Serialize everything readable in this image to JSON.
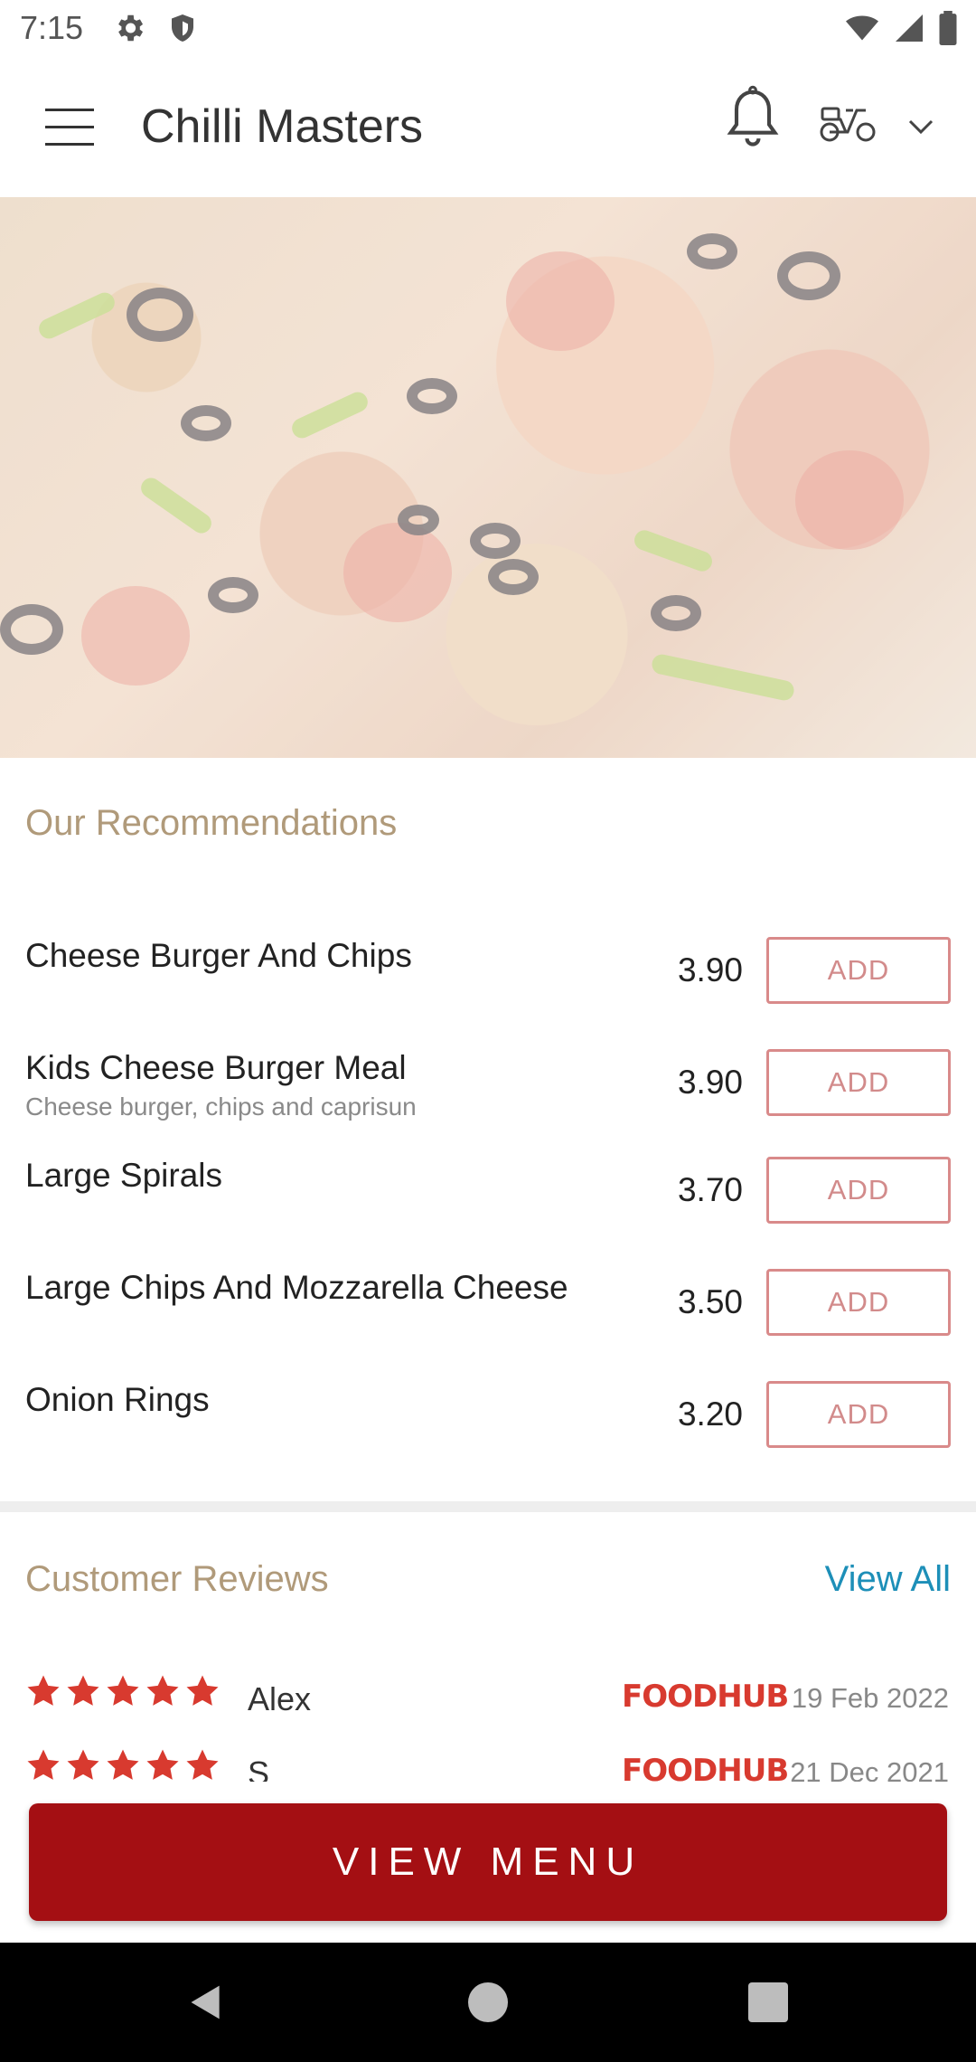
{
  "status_bar": {
    "time": "7:15",
    "left_icons": [
      "gear-icon",
      "shield-icon"
    ],
    "right_icons": [
      "wifi-icon",
      "signal-icon",
      "battery-icon"
    ]
  },
  "app_bar": {
    "title": "Chilli Masters",
    "icons": [
      "menu-icon",
      "bell-icon",
      "scooter-icon",
      "chevron-down-icon"
    ]
  },
  "recommendations": {
    "title": "Our Recommendations",
    "items": [
      {
        "name": "Cheese Burger And Chips",
        "description": "",
        "price": "3.90",
        "button": "ADD"
      },
      {
        "name": "Kids Cheese Burger Meal",
        "description": "Cheese burger, chips and caprisun",
        "price": "3.90",
        "button": "ADD"
      },
      {
        "name": "Large Spirals",
        "description": "",
        "price": "3.70",
        "button": "ADD"
      },
      {
        "name": "Large Chips And Mozzarella Cheese",
        "description": "",
        "price": "3.50",
        "button": "ADD"
      },
      {
        "name": "Onion Rings",
        "description": "",
        "price": "3.20",
        "button": "ADD"
      }
    ]
  },
  "reviews": {
    "title": "Customer Reviews",
    "view_all": "View All",
    "items": [
      {
        "rating": 5,
        "name": "Alex",
        "source": "FOODHUB",
        "date": "19 Feb 2022"
      },
      {
        "rating": 5,
        "name": "S",
        "source": "FOODHUB",
        "date": "21 Dec 2021"
      }
    ]
  },
  "cta": {
    "label": "VIEW MENU"
  },
  "colors": {
    "accent": "#a40f13",
    "section_title": "#b09a7a",
    "link": "#1d8fb8",
    "add_border": "#d98a8a",
    "star": "#d83a2f"
  }
}
